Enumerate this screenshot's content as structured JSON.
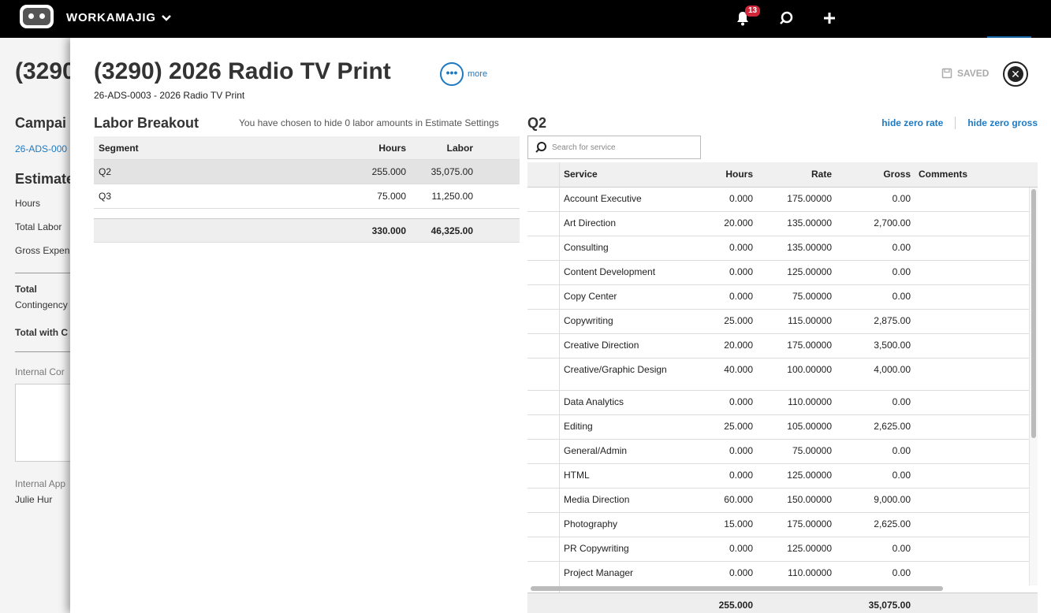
{
  "topbar": {
    "brand": "WORKAMAJIG",
    "notification_count": "13"
  },
  "background": {
    "title": "(3290",
    "campaign_heading": "Campai",
    "campaign_link": "26-ADS-000",
    "estimate_heading": "Estimate",
    "hours_label": "Hours",
    "total_labor_label": "Total Labor",
    "gross_expense_label": "Gross Expen",
    "total_label": "Total",
    "contingency_label": "Contingency",
    "total_with_label": "Total with C",
    "internal_comments_label": "Internal Cor",
    "internal_approver_label": "Internal App",
    "approver_name": "Julie Hur"
  },
  "panel": {
    "title": "(3290) 2026 Radio TV Print",
    "more_label": "more",
    "subtitle": "26-ADS-0003 - 2026 Radio TV Print",
    "saved_label": "SAVED"
  },
  "labor_breakout": {
    "title": "Labor Breakout",
    "note": "You have chosen to hide 0 labor amounts in Estimate Settings",
    "columns": [
      "Segment",
      "Hours",
      "Labor"
    ],
    "rows": [
      {
        "segment": "Q2",
        "hours": "255.000",
        "labor": "35,075.00"
      },
      {
        "segment": "Q3",
        "hours": "75.000",
        "labor": "11,250.00"
      }
    ],
    "total": {
      "hours": "330.000",
      "labor": "46,325.00"
    }
  },
  "q2": {
    "title": "Q2",
    "hide_zero_rate": "hide zero rate",
    "hide_zero_gross": "hide zero gross",
    "search_placeholder": "Search for service",
    "columns": [
      "Service",
      "Hours",
      "Rate",
      "Gross",
      "Comments"
    ],
    "rows": [
      {
        "service": "Account Executive",
        "hours": "0.000",
        "rate": "175.00000",
        "gross": "0.00"
      },
      {
        "service": "Art Direction",
        "hours": "20.000",
        "rate": "135.00000",
        "gross": "2,700.00"
      },
      {
        "service": "Consulting",
        "hours": "0.000",
        "rate": "135.00000",
        "gross": "0.00"
      },
      {
        "service": "Content Development",
        "hours": "0.000",
        "rate": "125.00000",
        "gross": "0.00"
      },
      {
        "service": "Copy Center",
        "hours": "0.000",
        "rate": "75.00000",
        "gross": "0.00"
      },
      {
        "service": "Copywriting",
        "hours": "25.000",
        "rate": "115.00000",
        "gross": "2,875.00"
      },
      {
        "service": "Creative Direction",
        "hours": "20.000",
        "rate": "175.00000",
        "gross": "3,500.00"
      },
      {
        "service": "Creative/Graphic Design",
        "hours": "40.000",
        "rate": "100.00000",
        "gross": "4,000.00"
      },
      {
        "service": "Data Analytics",
        "hours": "0.000",
        "rate": "110.00000",
        "gross": "0.00"
      },
      {
        "service": "Editing",
        "hours": "25.000",
        "rate": "105.00000",
        "gross": "2,625.00"
      },
      {
        "service": "General/Admin",
        "hours": "0.000",
        "rate": "75.00000",
        "gross": "0.00"
      },
      {
        "service": "HTML",
        "hours": "0.000",
        "rate": "125.00000",
        "gross": "0.00"
      },
      {
        "service": "Media Direction",
        "hours": "60.000",
        "rate": "150.00000",
        "gross": "9,000.00"
      },
      {
        "service": "Photography",
        "hours": "15.000",
        "rate": "175.00000",
        "gross": "2,625.00"
      },
      {
        "service": "PR Copywriting",
        "hours": "0.000",
        "rate": "125.00000",
        "gross": "0.00"
      },
      {
        "service": "Project Manager",
        "hours": "0.000",
        "rate": "110.00000",
        "gross": "0.00"
      }
    ],
    "total": {
      "hours": "255.000",
      "gross": "35,075.00"
    }
  }
}
